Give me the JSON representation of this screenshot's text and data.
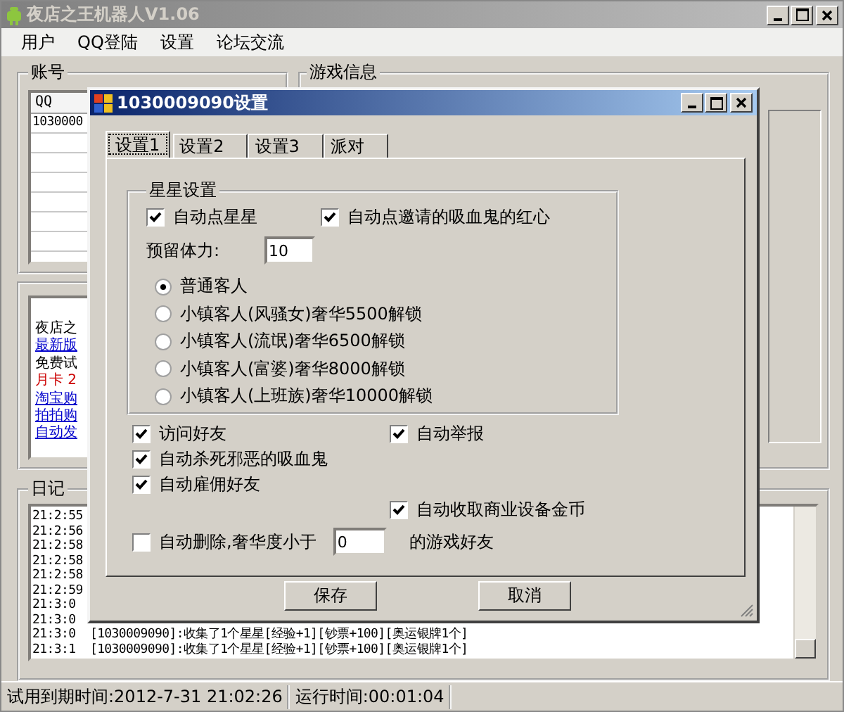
{
  "window": {
    "title": "夜店之王机器人V1.06"
  },
  "menu": [
    "用户",
    "QQ登陆",
    "设置",
    "论坛交流"
  ],
  "account_group": {
    "title": "账号",
    "columns": [
      "QQ"
    ],
    "rows": [
      "1030000"
    ]
  },
  "game_info_group": {
    "title": "游戏信息"
  },
  "info_box": {
    "lines": [
      {
        "text": "夜店之",
        "kind": "text"
      },
      {
        "text": "最新版",
        "kind": "link"
      },
      {
        "text": "免费试",
        "kind": "text"
      },
      {
        "text": "月卡 2",
        "kind": "highlight"
      },
      {
        "text": "淘宝购",
        "kind": "link"
      },
      {
        "text": "拍拍购",
        "kind": "link"
      },
      {
        "text": "自动发",
        "kind": "link"
      }
    ]
  },
  "log_group": {
    "title": "日记",
    "lines": [
      "21:2:55",
      "21:2:56",
      "21:2:58",
      "21:2:58",
      "21:2:58",
      "21:2:59",
      "21:3:0",
      "21:3:0",
      "21:3:0  [1030009090]:收集了1个星星[经验+1][钞票+100][奥运银牌1个]",
      "21:3:1  [1030009090]:收集了1个星星[经验+1][钞票+100][奥运银牌1个]"
    ]
  },
  "status_bar": [
    "试用到期时间:2012-7-31 21:02:26",
    "运行时间:00:01:04"
  ],
  "dialog": {
    "title": "1030009090设置",
    "tabs": [
      {
        "label": "设置1",
        "selected": true
      },
      {
        "label": "设置2",
        "selected": false
      },
      {
        "label": "设置3",
        "selected": false
      },
      {
        "label": "派对",
        "selected": false
      }
    ],
    "star_group": {
      "title": "星星设置",
      "checkboxes": [
        {
          "label": "自动点星星",
          "checked": true
        },
        {
          "label": "自动点邀请的吸血鬼的红心",
          "checked": true
        }
      ],
      "reserve": {
        "label": "预留体力:",
        "value": "10"
      },
      "radios": [
        {
          "label": "普通客人",
          "selected": true
        },
        {
          "label": "小镇客人(风骚女)奢华5500解锁",
          "selected": false
        },
        {
          "label": "小镇客人(流氓)奢华6500解锁",
          "selected": false
        },
        {
          "label": "小镇客人(富婆)奢华8000解锁",
          "selected": false
        },
        {
          "label": "小镇客人(上班族)奢华10000解锁",
          "selected": false
        }
      ]
    },
    "options": [
      {
        "label": "访问好友",
        "checked": true
      },
      {
        "label": "自动举报",
        "checked": true
      },
      {
        "label": "自动杀死邪恶的吸血鬼",
        "checked": true
      },
      {
        "label": "自动雇佣好友",
        "checked": true
      },
      {
        "label": "自动收取商业设备金币",
        "checked": true
      }
    ],
    "delete_option": {
      "label": "自动删除,奢华度小于",
      "checked": false,
      "value": "0",
      "suffix": "的游戏好友"
    },
    "buttons": [
      "保存",
      "取消"
    ]
  }
}
